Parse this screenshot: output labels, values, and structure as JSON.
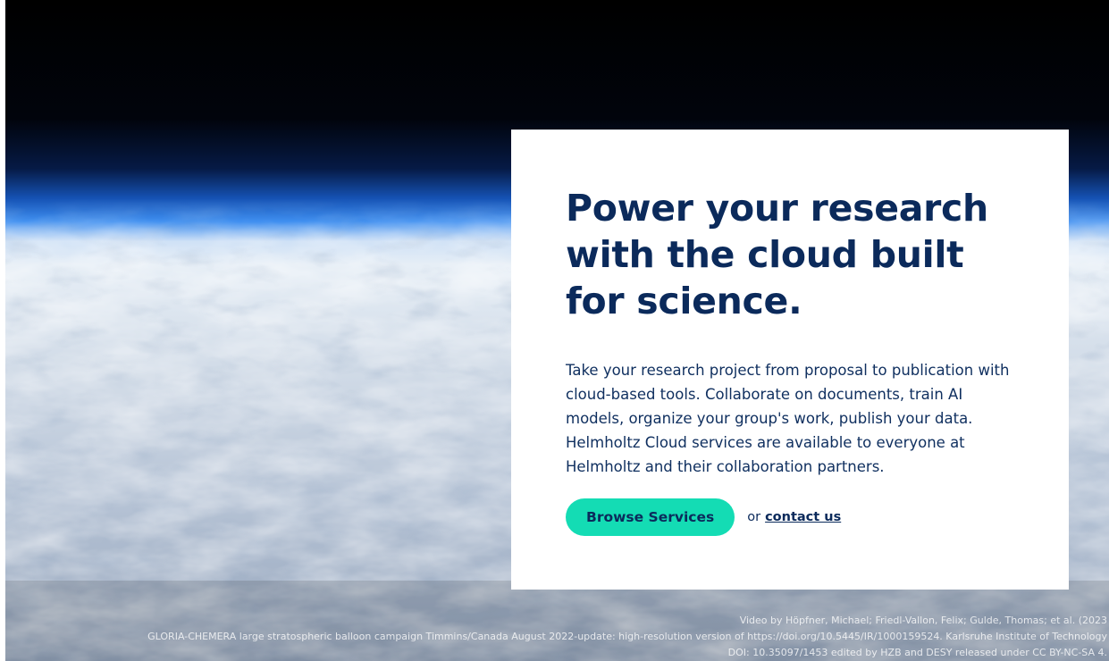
{
  "hero": {
    "title": "Power your research with the cloud built for science.",
    "description": "Take your research project from proposal to publication with cloud-based tools. Collaborate on documents, train AI models, organize your group's work, publish your data. Helmholtz Cloud services are available to everyone at Helmholtz and their collaboration partners.",
    "browse_button_label": "Browse Services",
    "or_text": "or",
    "contact_link_label": "contact us"
  },
  "credit": {
    "line1": "Video by Höpfner, Michael; Friedl-Vallon, Felix; Gulde, Thomas; et al. (2023",
    "line2": "GLORIA-CHEMERA large stratospheric balloon campaign Timmins/Canada August 2022-update: high-resolution version of https://doi.org/10.5445/IR/1000159524. Karlsruhe Institute of Technology",
    "line3": "DOI: 10.35097/1453 edited by HZB and DESY released under CC BY-NC-SA 4."
  },
  "colors": {
    "accent": "#14dcb4",
    "heading_navy": "#0b2a5b",
    "card_background": "#ffffff"
  }
}
